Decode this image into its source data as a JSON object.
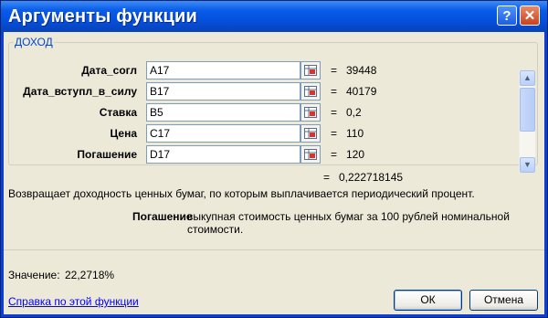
{
  "window": {
    "title": "Аргументы функции",
    "help_label": "?",
    "close_label": "✕"
  },
  "function_name": "ДОХОД",
  "args": [
    {
      "label": "Дата_согл",
      "value": "A17",
      "result": "39448"
    },
    {
      "label": "Дата_вступл_в_силу",
      "value": "B17",
      "result": "40179"
    },
    {
      "label": "Ставка",
      "value": "B5",
      "result": "0,2"
    },
    {
      "label": "Цена",
      "value": "C17",
      "result": "110"
    },
    {
      "label": "Погашение",
      "value": "D17",
      "result": "120"
    }
  ],
  "equals_sign": "=",
  "formula_result": "0,222718145",
  "description": "Возвращает доходность ценных бумаг, по которым выплачивается периодический процент.",
  "arg_help": {
    "name": "Погашение",
    "text_line1": "выкупная стоимость ценных бумаг за 100 рублей номинальной",
    "text_line2": "стоимости."
  },
  "value_label": "Значение:",
  "value": "22,2718%",
  "help_link": "Справка по этой функции",
  "ok_label": "ОК",
  "cancel_label": "Отмена",
  "icons": {
    "range_button": "range-select-icon",
    "scroll_up": "scroll-up-icon",
    "scroll_down": "scroll-down-icon"
  },
  "colors": {
    "titlebar": "#0a5ce8",
    "dialog_bg": "#ece9d8",
    "legend": "#0046d5",
    "link": "#0000ff"
  }
}
